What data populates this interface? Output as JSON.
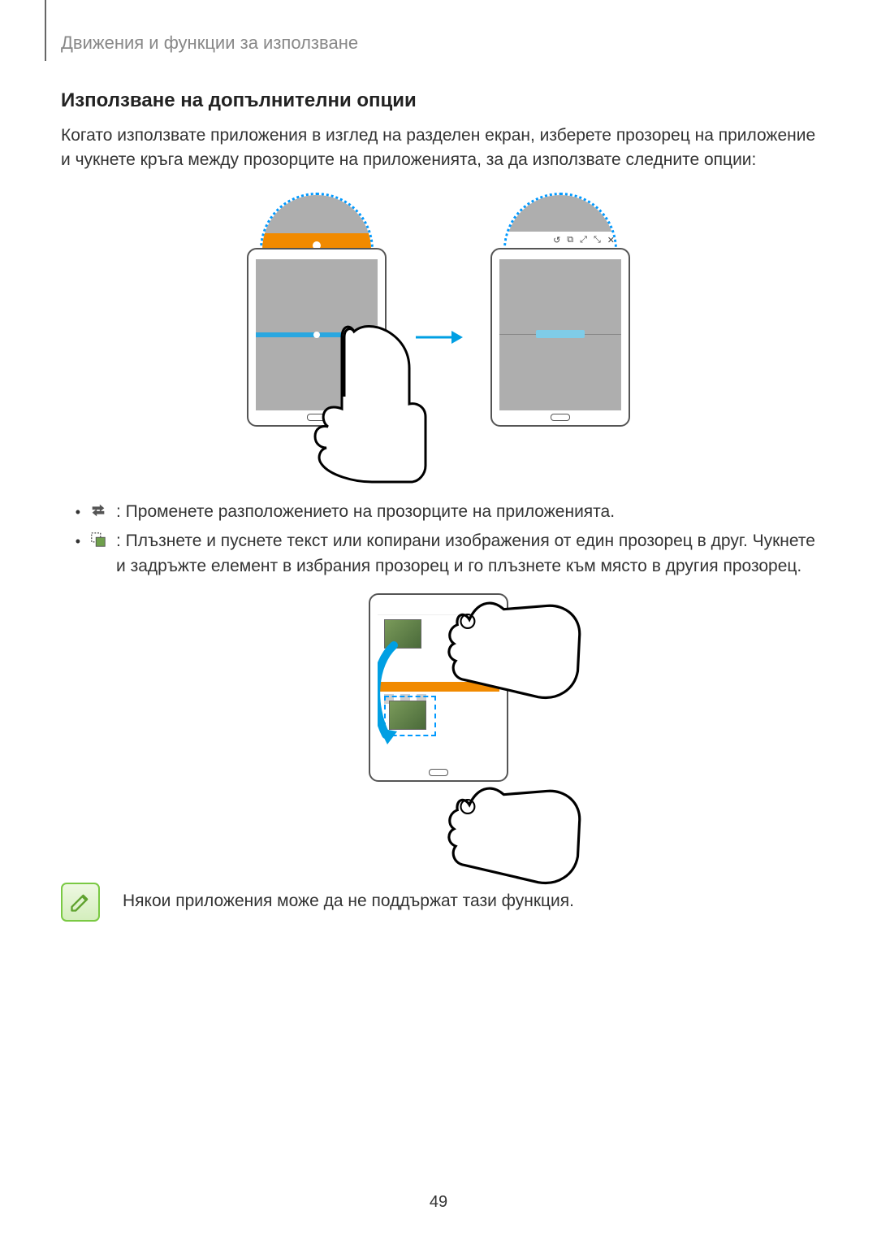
{
  "header": "Движения и функции за използване",
  "section_title": "Използване на допълнителни опции",
  "paragraph": "Когато използвате приложения в изглед на разделен екран, изберете прозорец на приложение и чукнете кръга между прозорците на приложенията, за да използвате следните опции:",
  "bullets": {
    "swap": " : Променете разположението на прозорците на приложенията.",
    "drag": " : Плъзнете и пуснете текст или копирани изображения от един прозорец в друг. Чукнете и задръжте елемент в избрания прозорец и го плъзнете към място в другия прозорец."
  },
  "note_text": "Някои приложения може да не поддържат тази функция.",
  "page_number": "49",
  "icons": {
    "swap": "swap-windows-icon",
    "drag": "drag-drop-icon",
    "note": "note-pencil-icon"
  },
  "toolbar_glyphs": [
    "↺",
    "⧉",
    "⤢",
    "⤡",
    "✕"
  ]
}
